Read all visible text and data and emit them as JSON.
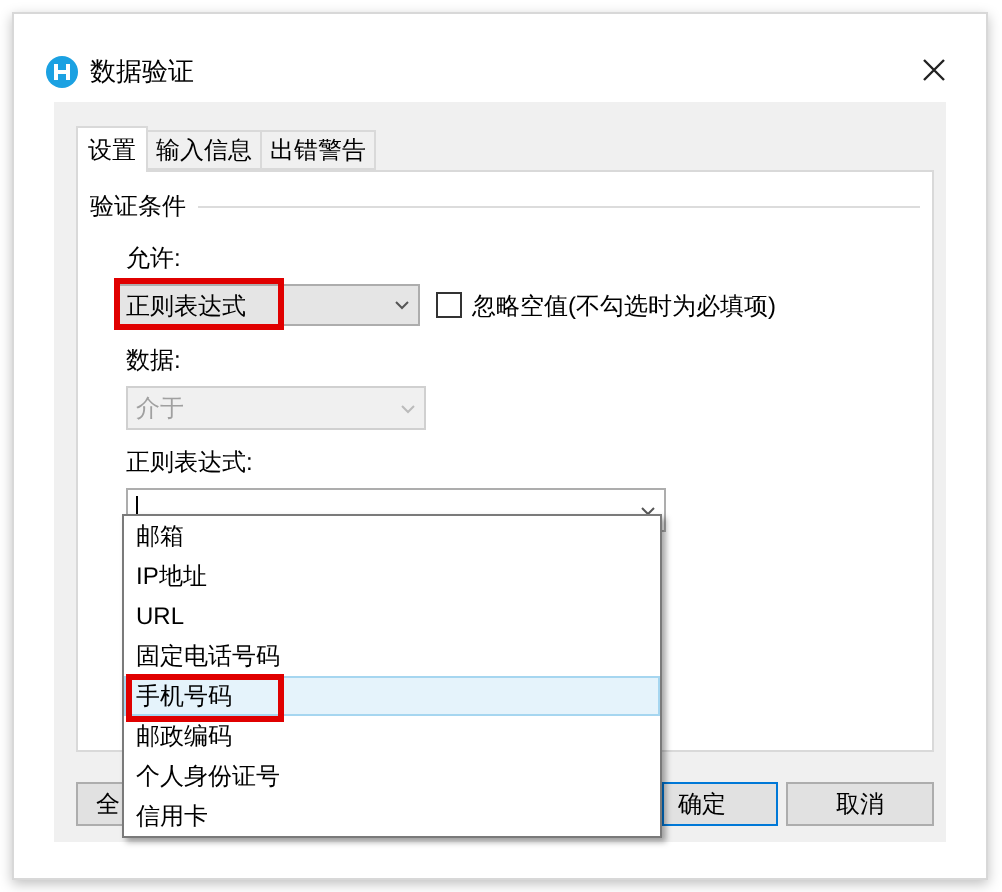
{
  "window": {
    "title": "数据验证"
  },
  "tabs": [
    {
      "label": "设置",
      "selected": true
    },
    {
      "label": "输入信息",
      "selected": false
    },
    {
      "label": "出错警告",
      "selected": false
    }
  ],
  "section_title": "验证条件",
  "allow": {
    "label": "允许:",
    "value": "正则表达式",
    "highlighted": true
  },
  "ignore_blank": {
    "label": "忽略空值(不勾选时为必填项)",
    "checked": false
  },
  "data": {
    "label": "数据:",
    "value": "介于",
    "disabled": true
  },
  "regex": {
    "label": "正则表达式:",
    "expanded": true,
    "options": [
      {
        "label": "邮箱",
        "selected": false,
        "highlighted": false
      },
      {
        "label": "IP地址",
        "selected": false,
        "highlighted": false
      },
      {
        "label": "URL",
        "selected": false,
        "highlighted": false
      },
      {
        "label": "固定电话号码",
        "selected": false,
        "highlighted": false
      },
      {
        "label": "手机号码",
        "selected": true,
        "highlighted": true
      },
      {
        "label": "邮政编码",
        "selected": false,
        "highlighted": false
      },
      {
        "label": "个人身份证号",
        "selected": false,
        "highlighted": false
      },
      {
        "label": "信用卡",
        "selected": false,
        "highlighted": false
      }
    ]
  },
  "buttons": [
    {
      "label": "全",
      "default": false
    },
    {
      "label": "确定",
      "default": true
    },
    {
      "label": "取消",
      "default": false
    }
  ]
}
